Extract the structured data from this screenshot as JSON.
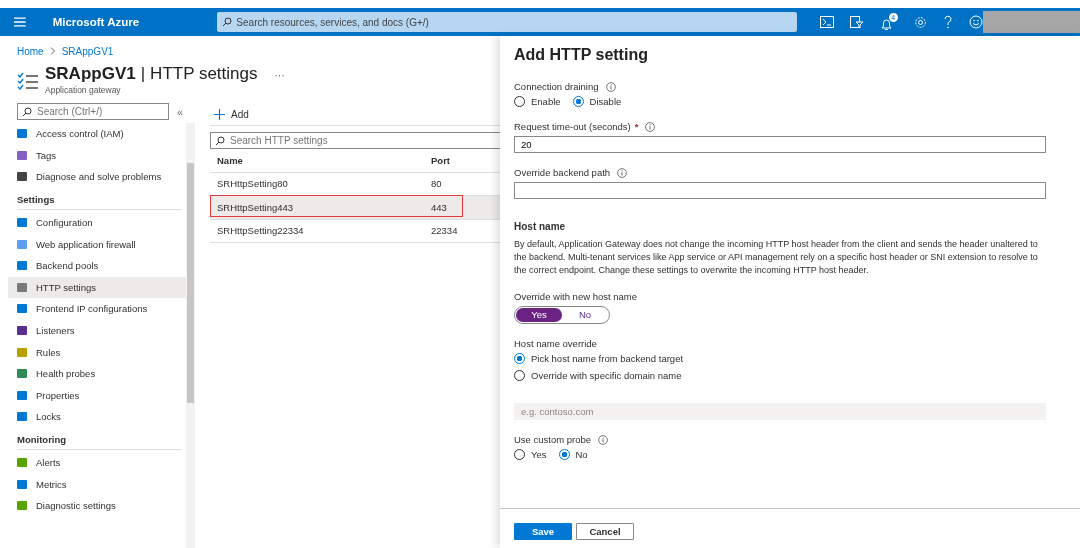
{
  "topbar": {
    "brand": "Microsoft Azure",
    "search": {
      "placeholder": "Search resources, services, and docs (G+/)"
    },
    "notification_count": "4"
  },
  "breadcrumb": [
    "Home",
    "SRAppGV1"
  ],
  "header": {
    "title": "SRAppGV1",
    "separator": "|",
    "section": "HTTP settings",
    "more": "···",
    "subtitle": "Application gateway"
  },
  "sidebar": {
    "search": {
      "placeholder": "Search (Ctrl+/)"
    },
    "collapse": "«",
    "groups": [
      {
        "items": [
          {
            "label": "Access control (IAM)",
            "selected": false
          },
          {
            "label": "Tags",
            "selected": false
          },
          {
            "label": "Diagnose and solve problems",
            "selected": false
          }
        ]
      },
      {
        "heading": "Settings",
        "items": [
          {
            "label": "Configuration",
            "selected": false
          },
          {
            "label": "Web application firewall",
            "selected": false
          },
          {
            "label": "Backend pools",
            "selected": false
          },
          {
            "label": "HTTP settings",
            "selected": true
          },
          {
            "label": "Frontend IP configurations",
            "selected": false
          },
          {
            "label": "Listeners",
            "selected": false
          },
          {
            "label": "Rules",
            "selected": false
          },
          {
            "label": "Health probes",
            "selected": false
          },
          {
            "label": "Properties",
            "selected": false
          },
          {
            "label": "Locks",
            "selected": false
          }
        ]
      },
      {
        "heading": "Monitoring",
        "items": [
          {
            "label": "Alerts",
            "selected": false
          },
          {
            "label": "Metrics",
            "selected": false
          },
          {
            "label": "Diagnostic settings",
            "selected": false
          }
        ]
      }
    ]
  },
  "toolbar": {
    "add": "Add"
  },
  "list": {
    "search": {
      "placeholder": "Search HTTP settings"
    },
    "columns": [
      "Name",
      "Port"
    ],
    "rows": [
      {
        "name": "SRHttpSetting80",
        "port": "80",
        "selected": false,
        "outlined": false
      },
      {
        "name": "SRHttpSetting443",
        "port": "443",
        "selected": true,
        "outlined": true
      },
      {
        "name": "SRHttpSetting22334",
        "port": "22334",
        "selected": false,
        "outlined": false
      }
    ]
  },
  "panel": {
    "title": "Add HTTP setting",
    "fields": [
      {
        "kind": "radio",
        "label": "Connection draining",
        "info": true,
        "options": [
          {
            "label": "Enable",
            "selected": false
          },
          {
            "label": "Disable",
            "selected": true
          }
        ]
      },
      {
        "kind": "text",
        "label": "Request time-out (seconds)",
        "required_mark": "*",
        "info": true,
        "value": "20"
      },
      {
        "kind": "text",
        "label": "Override backend path",
        "info": true
      },
      {
        "kind": "heading",
        "text": "Host name"
      },
      {
        "kind": "paragraph",
        "text": "By default, Application Gateway does not change the incoming HTTP host header from the client and sends the header unaltered to the backend. Multi-tenant services like App service or API management rely on a specific host header or SNI extension to resolve to the correct endpoint. Change these settings to overwrite the incoming HTTP host header."
      },
      {
        "kind": "toggle",
        "label": "Override with new host name",
        "options": [
          {
            "label": "Yes",
            "selected": true
          },
          {
            "label": "No",
            "selected": false
          }
        ]
      },
      {
        "kind": "radio_list",
        "label": "Host name override",
        "options": [
          {
            "label": "Pick host name from backend target",
            "selected": true
          },
          {
            "label": "Override with specific domain name",
            "selected": false
          }
        ]
      },
      {
        "kind": "text",
        "placeholder": "e.g. contoso.com",
        "disabled": true
      },
      {
        "kind": "radio",
        "label": "Use custom probe",
        "info": true,
        "options": [
          {
            "label": "Yes",
            "selected": false
          },
          {
            "label": "No",
            "selected": true
          }
        ]
      }
    ],
    "buttons": [
      {
        "label": "Save",
        "primary": true
      },
      {
        "label": "Cancel",
        "primary": false
      }
    ]
  }
}
